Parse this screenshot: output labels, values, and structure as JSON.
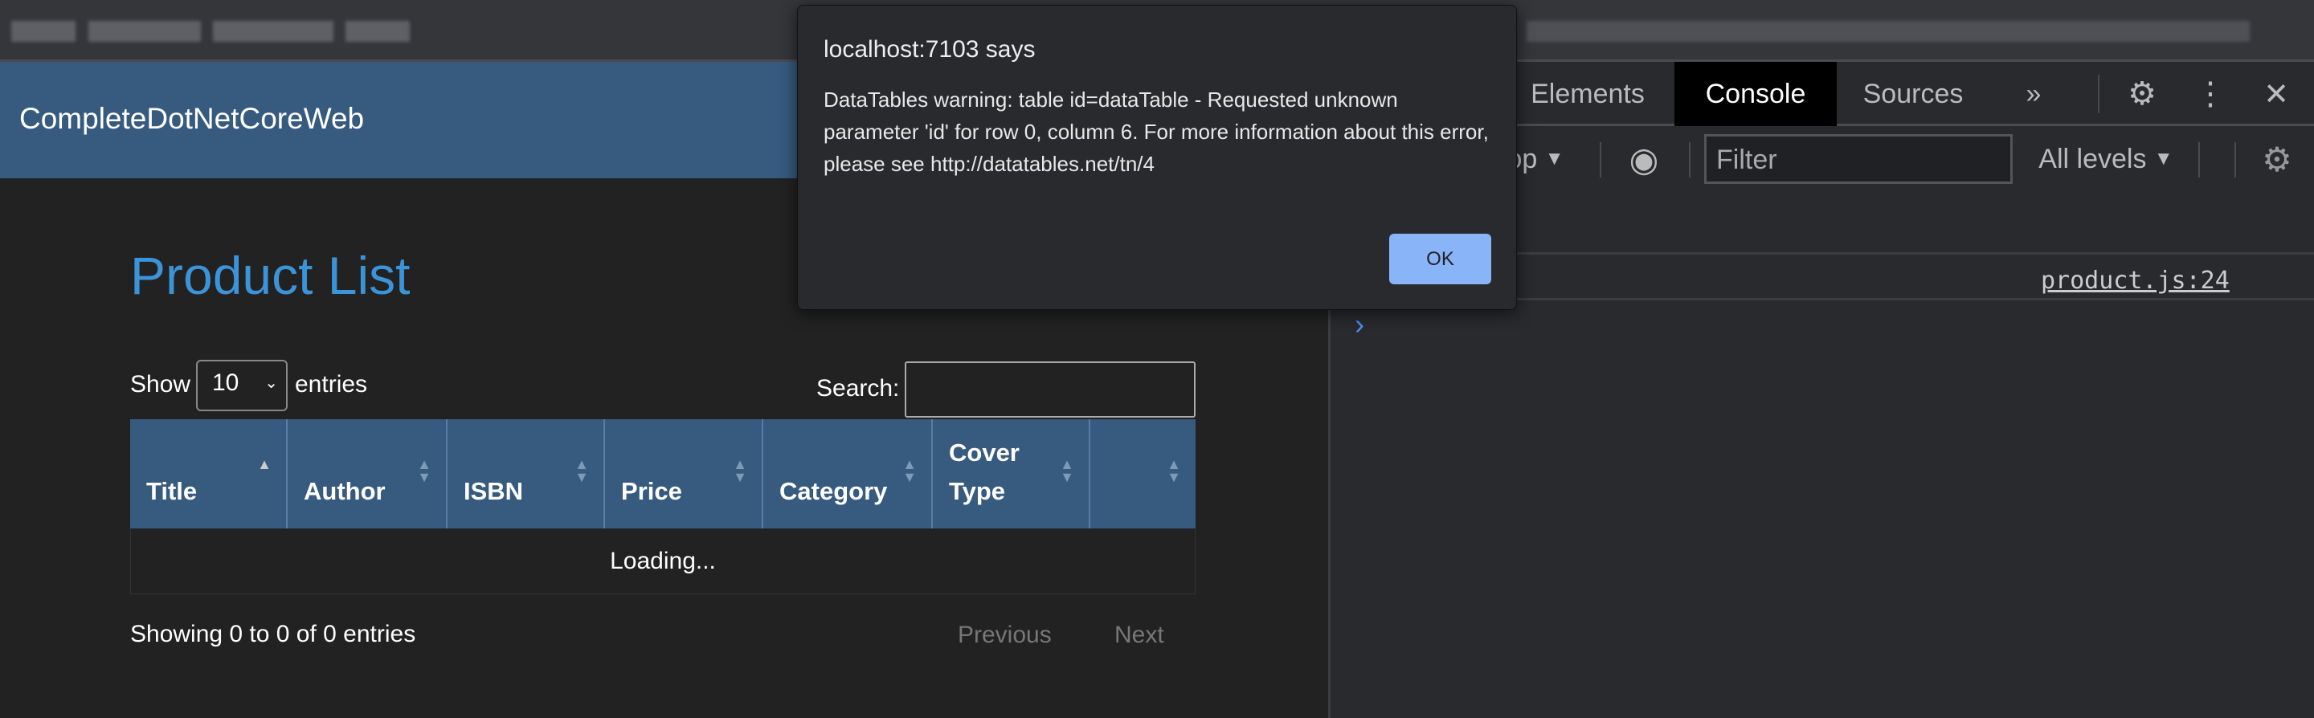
{
  "navbar": {
    "brand": "CompleteDotNetCoreWeb"
  },
  "main": {
    "title": "Product List",
    "show_label": "Show",
    "entries_select": "10",
    "entries_label": "entries",
    "search_label": "Search:",
    "search_value": "",
    "columns": [
      "Title",
      "Author",
      "ISBN",
      "Price",
      "Category",
      "Cover Type",
      ""
    ],
    "loading": "Loading...",
    "info": "Showing 0 to 0 of 0 entries",
    "prev": "Previous",
    "next": "Next"
  },
  "dialog": {
    "title": "localhost:7103 says",
    "message": "DataTables warning: table id=dataTable - Requested unknown parameter 'id' for row 0, column 6. For more information about this error, please see http://datatables.net/tn/4",
    "ok": "OK"
  },
  "devtools": {
    "tabs": [
      "Elements",
      "Console",
      "Sources"
    ],
    "more": "»",
    "context": "op",
    "filter_placeholder": "Filter",
    "levels": "All levels",
    "source_link": "product.js:24",
    "prompt": "›"
  },
  "colors": {
    "navbar": "#375a7f",
    "title": "#3b93d8",
    "ok": "#8ab4f8"
  }
}
